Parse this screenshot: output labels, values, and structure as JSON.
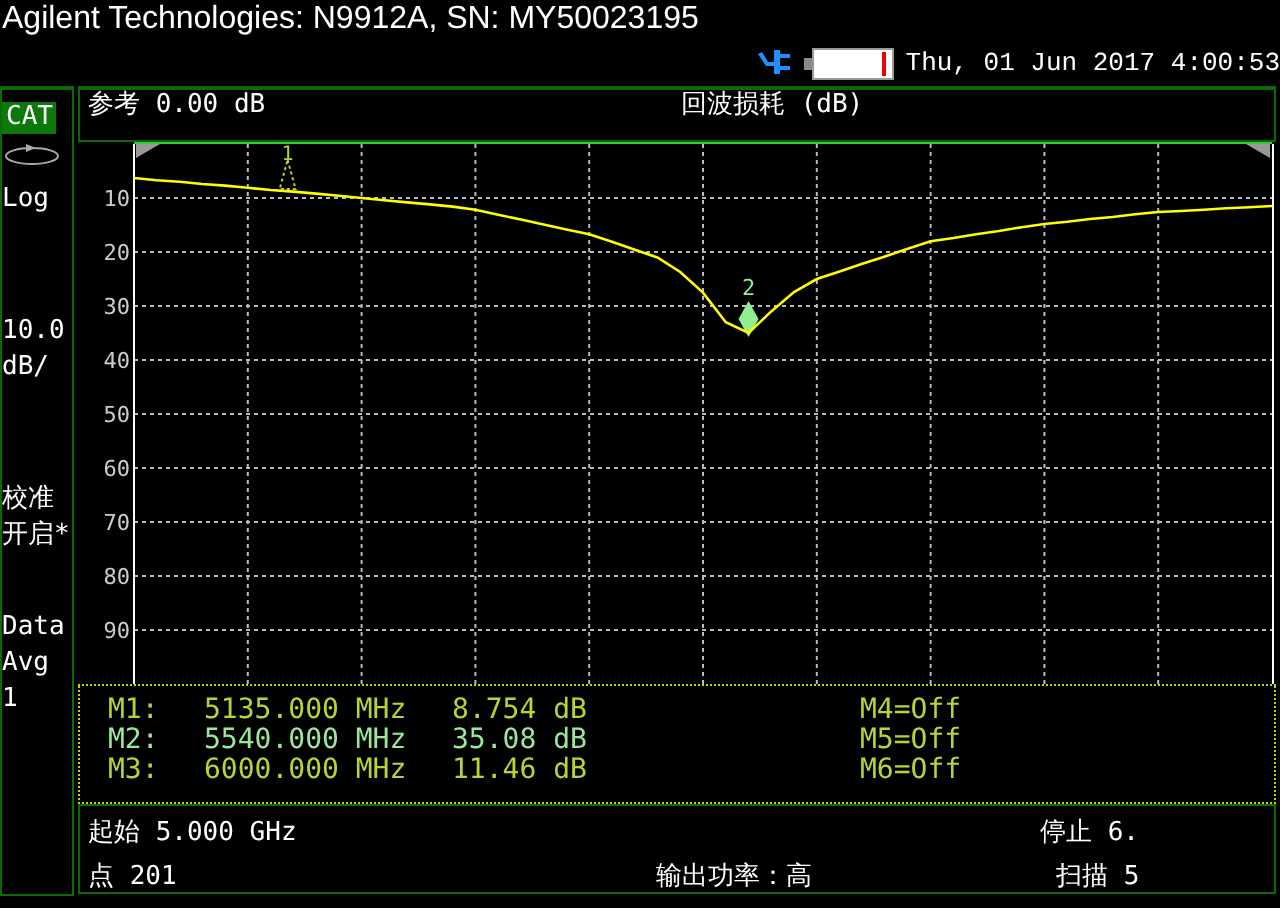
{
  "window": {
    "title": "Agilent Technologies: N9912A, SN: MY50023195"
  },
  "status_bar": {
    "datetime": "Thu, 01 Jun 2017 4:00:53"
  },
  "sidebar": {
    "items": [
      {
        "kind": "badge",
        "lines": [
          "CAT"
        ],
        "selected": true
      },
      {
        "kind": "icon"
      },
      {
        "kind": "text",
        "lines": [
          "Log"
        ]
      },
      {
        "kind": "text",
        "lines": [
          "10.0",
          "dB/"
        ]
      },
      {
        "kind": "text",
        "lines": [
          "校准",
          "开启*"
        ]
      },
      {
        "kind": "text",
        "lines": [
          "Data"
        ]
      },
      {
        "kind": "text",
        "lines": [
          "Avg",
          "1"
        ]
      }
    ]
  },
  "trace": {
    "reference": "参考 0.00 dB",
    "title": "回波损耗 (dB)",
    "chart_data": {
      "type": "line",
      "ylim": [
        100,
        0
      ],
      "yticks": [
        10,
        20,
        30,
        40,
        50,
        60,
        70,
        80,
        90
      ],
      "grid": true,
      "categories": [
        null,
        null,
        null,
        null,
        null,
        null,
        null,
        null,
        null,
        null,
        null,
        null,
        null,
        null,
        null,
        null,
        null,
        null,
        null,
        null,
        null,
        null,
        null,
        null,
        null,
        null,
        null,
        null,
        null,
        null,
        null,
        null,
        null,
        null,
        null,
        null,
        null,
        null,
        null,
        null,
        null,
        null,
        null,
        null,
        null,
        null,
        null,
        null,
        null,
        null,
        null
      ],
      "series": [
        {
          "color": "#ffff00",
          "values": [
            6.3,
            6.7,
            7.0,
            7.4,
            7.7,
            8.1,
            8.5,
            8.8,
            9.2,
            9.6,
            10.0,
            10.4,
            10.8,
            11.2,
            11.6,
            12.2,
            13.1,
            14.0,
            14.9,
            15.8,
            16.7,
            18.1,
            19.6,
            21.0,
            23.7,
            27.5,
            33.0,
            35.0,
            31.0,
            27.4,
            25.0,
            23.6,
            22.2,
            20.8,
            19.4,
            18.0,
            17.4,
            16.7,
            16.1,
            15.4,
            14.8,
            14.4,
            13.9,
            13.5,
            13.0,
            12.6,
            12.4,
            12.2,
            11.9,
            11.7,
            11.5
          ]
        }
      ]
    },
    "markers": [
      {
        "label": "1",
        "level": 0.135
      },
      {
        "label": "2",
        "level": 0.54
      }
    ]
  },
  "markers": [
    {
      "name": "M1:",
      "frequency": "5135.000 MHz",
      "value": "8.754 dB",
      "selected": false,
      "other": "M4=Off"
    },
    {
      "name": "M2:",
      "frequency": "5540.000 MHz",
      "value": "35.08 dB",
      "selected": true,
      "other": "M5=Off"
    },
    {
      "name": "M3:",
      "frequency": "6000.000 MHz",
      "value": "11.46 dB",
      "selected": false,
      "other": "M6=Off"
    }
  ],
  "sweep": {
    "start": "起始 5.000 GHz",
    "stop": "停止 6.",
    "points": "点 201",
    "power": "输出功率：高",
    "sweep_time": "扫描 5"
  }
}
